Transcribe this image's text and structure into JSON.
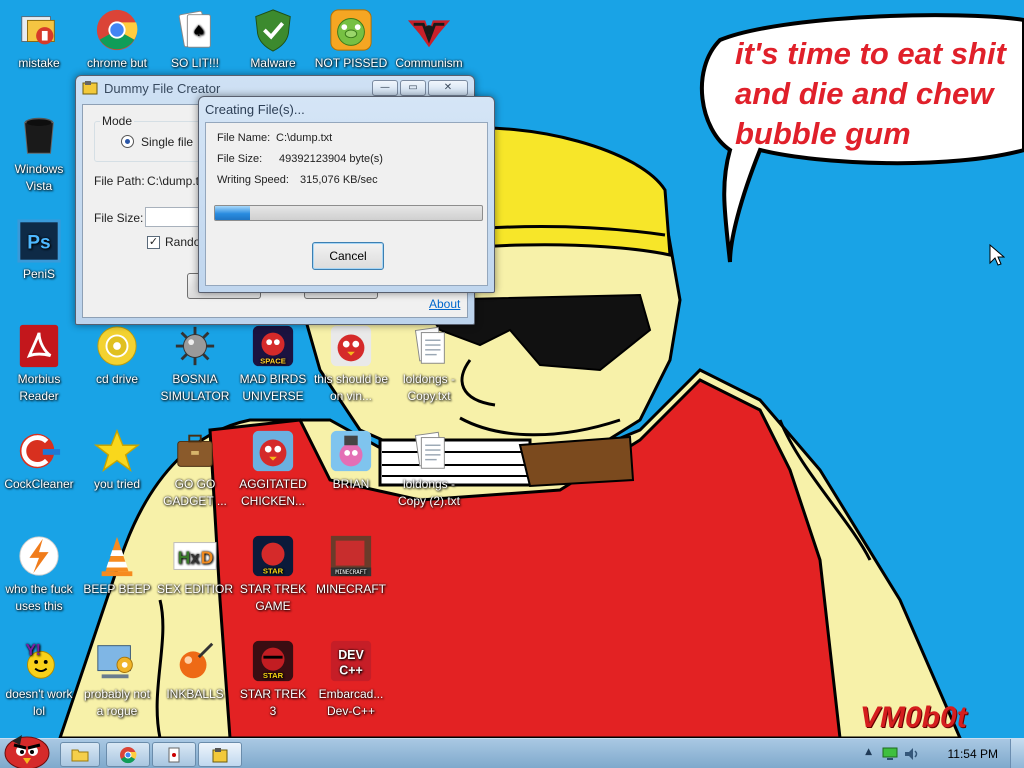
{
  "desktop": {
    "speech_bubble": {
      "line1": "it's time to eat shit",
      "line2": "and die and chew",
      "line3": "bubble gum"
    },
    "signature": "VM0b0t",
    "icons": [
      {
        "name": "mistake",
        "label": "mistake"
      },
      {
        "name": "chrome",
        "label": "chrome but"
      },
      {
        "name": "solitaire",
        "label": "SO LIT!!!"
      },
      {
        "name": "malware",
        "label": "Malware"
      },
      {
        "name": "not-pissed",
        "label": "NOT PISSED"
      },
      {
        "name": "communism",
        "label": "Communism"
      },
      {
        "name": "windows-vista",
        "label": "Windows Vista"
      },
      {
        "name": "penis",
        "label": "PeniS"
      },
      {
        "name": "morbius-reader",
        "label": "Morbius Reader"
      },
      {
        "name": "cd-drive",
        "label": "cd drive"
      },
      {
        "name": "bosnia-simulator",
        "label": "BOSNIA SIMULATOR"
      },
      {
        "name": "mad-birds",
        "label": "MAD BIRDS UNIVERSE"
      },
      {
        "name": "this-should",
        "label": "this should be on vin..."
      },
      {
        "name": "loldongs-copy",
        "label": "loldongs - Copy.txt"
      },
      {
        "name": "cockcleaner",
        "label": "CockCleaner"
      },
      {
        "name": "you-tried",
        "label": "you tried"
      },
      {
        "name": "go-go-gadget",
        "label": "GO GO GADGET ..."
      },
      {
        "name": "aggitated-chicken",
        "label": "AGGITATED CHICKEN..."
      },
      {
        "name": "brian",
        "label": "BRIAN"
      },
      {
        "name": "loldongs-copy-2",
        "label": "loldongs - Copy (2).txt"
      },
      {
        "name": "who-the-fuck",
        "label": "who the fuck uses this"
      },
      {
        "name": "beep-beep",
        "label": "BEEP BEEP"
      },
      {
        "name": "sex-editior",
        "label": "SEX EDITIOR"
      },
      {
        "name": "star-trek-game",
        "label": "STAR TREK GAME"
      },
      {
        "name": "minecraft",
        "label": "MINECRAFT"
      },
      {
        "name": "doesnt-work",
        "label": "doesn't work lol"
      },
      {
        "name": "probably-not-a-rogue",
        "label": "probably not a rogue"
      },
      {
        "name": "inkballs",
        "label": "INKBALLS"
      },
      {
        "name": "star-trek-3",
        "label": "STAR TREK 3"
      },
      {
        "name": "dev-cpp",
        "label": "Embarcad... Dev-C++"
      }
    ]
  },
  "dummy_file_creator": {
    "title": "Dummy File Creator",
    "mode_label": "Mode",
    "single_file_label": "Single file",
    "file_path_label": "File Path:",
    "file_path_value": "C:\\dump.txt",
    "file_size_label": "File Size:",
    "random_label": "Random",
    "about_link": "About"
  },
  "creating_files": {
    "title": "Creating File(s)...",
    "file_name_label": "File Name:",
    "file_name_value": "C:\\dump.txt",
    "file_size_label": "File Size:",
    "file_size_value": "49392123904 byte(s)",
    "writing_speed_label": "Writing Speed:",
    "writing_speed_value": "315,076 KB/sec",
    "progress_fraction": 0.13,
    "cancel_label": "Cancel"
  },
  "taskbar": {
    "clock": "11:54 PM"
  }
}
